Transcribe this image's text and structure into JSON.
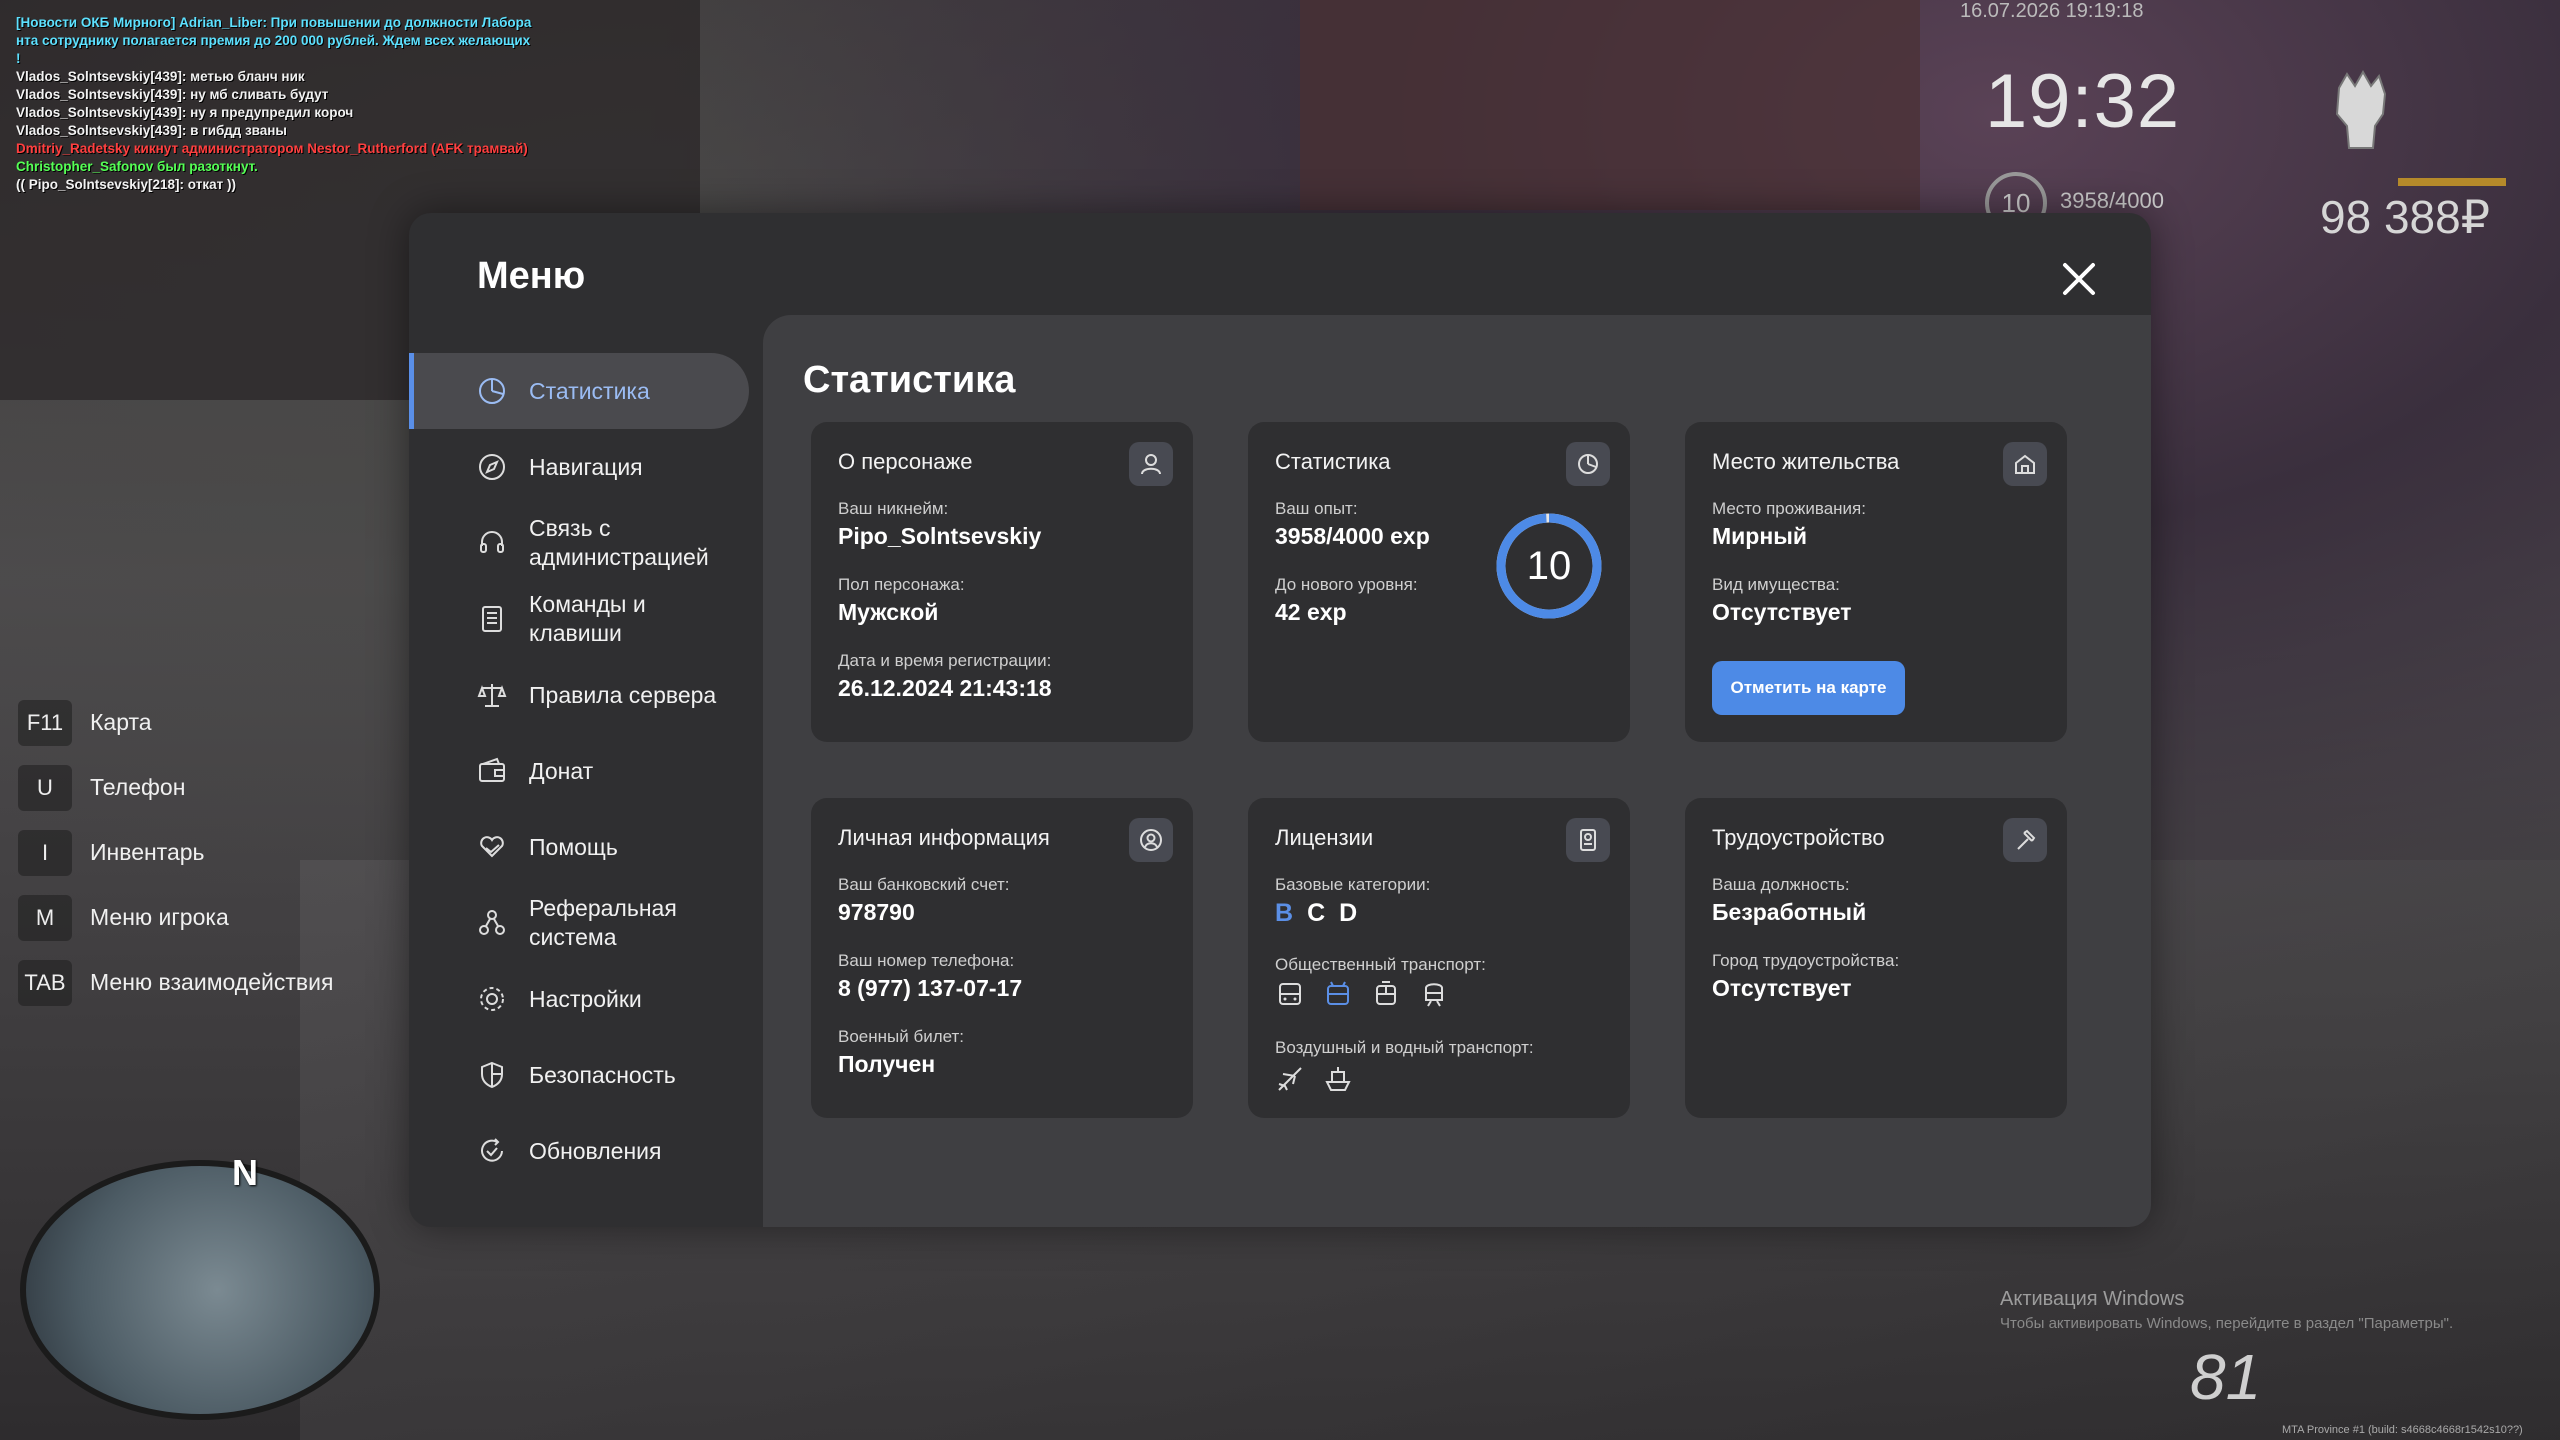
{
  "chat": [
    {
      "text": "[Новости ОКБ Мирного] Adrian_Liber: При повышении до должности Лабора",
      "color": "cyan"
    },
    {
      "text": "нта сотруднику полагается премия до 200 000 рублей. Ждем всех желающих",
      "color": "cyan"
    },
    {
      "text": "!",
      "color": "cyan"
    },
    {
      "text": "Vlados_Solntsevskiy[439]: метью бланч ник",
      "color": "white"
    },
    {
      "text": "Vlados_Solntsevskiy[439]: ну мб сливать будут",
      "color": "white"
    },
    {
      "text": "Vlados_Solntsevskiy[439]: ну я предупредил короч",
      "color": "white"
    },
    {
      "text": "Vlados_Solntsevskiy[439]: в гибдд званы",
      "color": "white"
    },
    {
      "text": "Dmitriy_Radetsky кикнут администратором Nestor_Rutherford (AFK трамвай)",
      "color": "red"
    },
    {
      "text": "Christopher_Safonov был разоткнут.",
      "color": "green"
    },
    {
      "text": "(( Pipo_Solntsevskiy[218]: откат ))",
      "color": "white"
    }
  ],
  "hud": {
    "date": "16.07.2026 19:19:18",
    "time": "19:32",
    "level": "10",
    "exp": "3958/4000",
    "money": "98 388₽",
    "speed": "81",
    "windows_title": "Активация Windows",
    "windows_sub": "Чтобы активировать Windows, перейдите в раздел \"Параметры\".",
    "build": "MTA Province #1 (build: s4668c4668r1542s10??)",
    "compass": "N"
  },
  "keys": [
    {
      "key": "F11",
      "label": "Карта"
    },
    {
      "key": "U",
      "label": "Телефон"
    },
    {
      "key": "I",
      "label": "Инвентарь"
    },
    {
      "key": "M",
      "label": "Меню игрока"
    },
    {
      "key": "TAB",
      "label": "Меню взаимодействия"
    }
  ],
  "menu": {
    "title": "Меню",
    "nav": [
      {
        "label": "Статистика",
        "icon": "chart-pie-icon",
        "active": true
      },
      {
        "label": "Навигация",
        "icon": "compass-icon"
      },
      {
        "label": "Связь с администрацией",
        "icon": "headset-icon"
      },
      {
        "label": "Команды и клавиши",
        "icon": "document-list-icon"
      },
      {
        "label": "Правила сервера",
        "icon": "scales-icon"
      },
      {
        "label": "Донат",
        "icon": "wallet-icon"
      },
      {
        "label": "Помощь",
        "icon": "heart-hand-icon"
      },
      {
        "label": "Реферальная система",
        "icon": "people-network-icon"
      },
      {
        "label": "Настройки",
        "icon": "gear-icon"
      },
      {
        "label": "Безопасность",
        "icon": "shield-icon"
      },
      {
        "label": "Обновления",
        "icon": "refresh-check-icon"
      }
    ],
    "content_title": "Статистика",
    "character": {
      "title": "О персонаже",
      "nick_label": "Ваш никнейм:",
      "nick": "Pipo_Solntsevskiy",
      "sex_label": "Пол персонажа:",
      "sex": "Мужской",
      "reg_label": "Дата и время регистрации:",
      "reg": "26.12.2024 21:43:18"
    },
    "stats": {
      "title": "Статистика",
      "exp_label": "Ваш опыт:",
      "exp": "3958/4000 exp",
      "next_label": "До нового уровня:",
      "next": "42 exp",
      "level": "10",
      "progress": 0.9895
    },
    "residence": {
      "title": "Место жительства",
      "place_label": "Место проживания:",
      "place": "Мирный",
      "property_label": "Вид имущества:",
      "property": "Отсутствует",
      "button": "Отметить на карте"
    },
    "personal": {
      "title": "Личная информация",
      "bank_label": "Ваш банковский счет:",
      "bank": "978790",
      "phone_label": "Ваш номер телефона:",
      "phone": "8 (977) 137-07-17",
      "military_label": "Военный билет:",
      "military": "Получен"
    },
    "licenses": {
      "title": "Лицензии",
      "base_label": "Базовые категории:",
      "categories": [
        {
          "letter": "B",
          "color": "#5b8fe6"
        },
        {
          "letter": "C",
          "color": "#ffffff"
        },
        {
          "letter": "D",
          "color": "#ffffff"
        }
      ],
      "public_label": "Общественный транспорт:",
      "air_label": "Воздушный и водный транспорт:"
    },
    "employment": {
      "title": "Трудоустройство",
      "position_label": "Ваша должность:",
      "position": "Безработный",
      "city_label": "Город трудоустройства:",
      "city": "Отсутствует"
    }
  }
}
